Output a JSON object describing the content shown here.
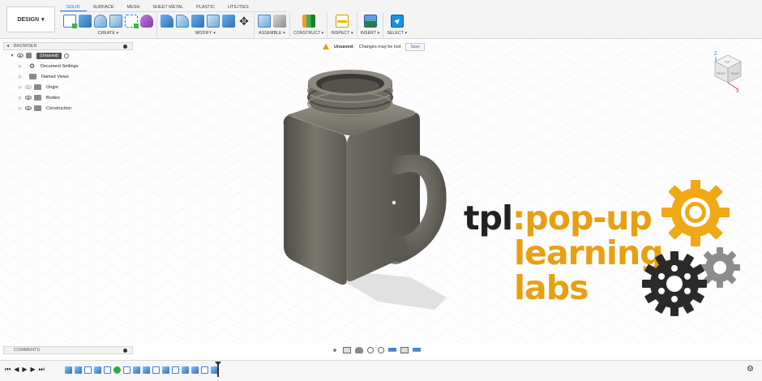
{
  "toolbar": {
    "workspace_label": "DESIGN",
    "tabs": [
      "SOLID",
      "SURFACE",
      "MESH",
      "SHEET METAL",
      "PLASTIC",
      "UTILITIES"
    ],
    "active_tab": "SOLID",
    "groups": [
      {
        "label": "CREATE ▾"
      },
      {
        "label": "MODIFY ▾"
      },
      {
        "label": "ASSEMBLE ▾"
      },
      {
        "label": "CONSTRUCT ▾"
      },
      {
        "label": "INSPECT ▾"
      },
      {
        "label": "INSERT ▾"
      },
      {
        "label": "SELECT ▾"
      }
    ]
  },
  "browser": {
    "title": "BROWSER",
    "items": [
      {
        "label": "(Unsaved)"
      },
      {
        "label": "Document Settings"
      },
      {
        "label": "Named Views"
      },
      {
        "label": "Origin"
      },
      {
        "label": "Bodies"
      },
      {
        "label": "Construction"
      }
    ]
  },
  "notice": {
    "title": "Unsaved:",
    "message": "Changes may be lost",
    "save_label": "Save"
  },
  "viewcube": {
    "z_label": "Z",
    "x_label": "X",
    "top_label": "TOP",
    "front_label": "FRONT",
    "right_label": "RIGHT"
  },
  "branding": {
    "prefix": "tpl",
    "colon": ":",
    "line1": "pop-up",
    "line2": "learning",
    "line3": "labs",
    "accent_color": "#e8a012"
  },
  "comments": {
    "title": "COMMENTS"
  },
  "colors": {
    "accent": "#1a6fd0",
    "toolbar_bg": "#f4f4f4"
  }
}
